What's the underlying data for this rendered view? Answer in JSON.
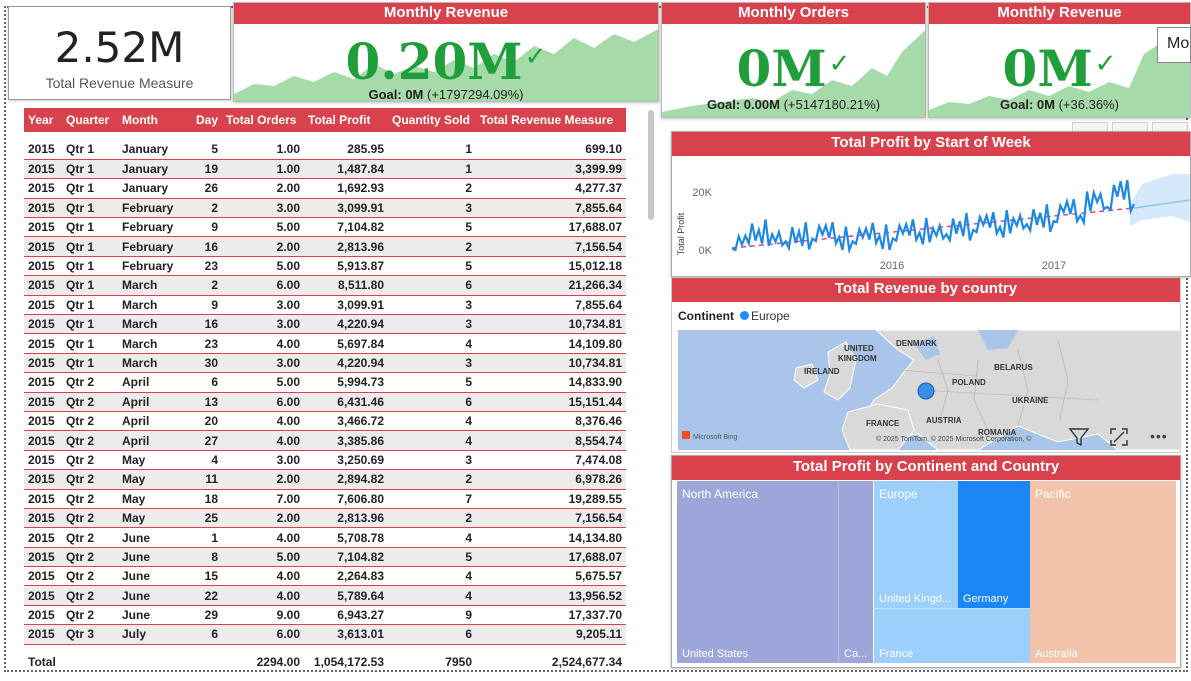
{
  "kpis": {
    "total_revenue": {
      "value": "2.52M",
      "label": "Total Revenue Measure"
    },
    "card1": {
      "title": "Monthly Revenue",
      "value": "0.20M",
      "goal_label": "Goal:",
      "goal_value": "0M",
      "delta": "(+1797294.09%)",
      "status_color": "#1f9e3a"
    },
    "card2": {
      "title": "Monthly Orders",
      "value": "0M",
      "goal_label": "Goal:",
      "goal_value": "0.00M",
      "delta": "(+5147180.21%)",
      "status_color": "#1f9e3a"
    },
    "card3": {
      "title": "Monthly Revenue",
      "value": "0M",
      "goal_label": "Goal:",
      "goal_value": "0M",
      "delta": "(+36.36%)",
      "status_color": "#1f9e3a"
    },
    "tick_glyph": "✓"
  },
  "tooltip": {
    "text": "Mo"
  },
  "table": {
    "columns": [
      "Year",
      "Quarter",
      "Month",
      "Day",
      "Total Orders",
      "Total Profit",
      "Quantity Sold",
      "Total Revenue Measure"
    ],
    "rows": [
      [
        "2015",
        "Qtr 1",
        "January",
        "5",
        "1.00",
        "285.95",
        "1",
        "699.10"
      ],
      [
        "2015",
        "Qtr 1",
        "January",
        "19",
        "1.00",
        "1,487.84",
        "1",
        "3,399.99"
      ],
      [
        "2015",
        "Qtr 1",
        "January",
        "26",
        "2.00",
        "1,692.93",
        "2",
        "4,277.37"
      ],
      [
        "2015",
        "Qtr 1",
        "February",
        "2",
        "3.00",
        "3,099.91",
        "3",
        "7,855.64"
      ],
      [
        "2015",
        "Qtr 1",
        "February",
        "9",
        "5.00",
        "7,104.82",
        "5",
        "17,688.07"
      ],
      [
        "2015",
        "Qtr 1",
        "February",
        "16",
        "2.00",
        "2,813.96",
        "2",
        "7,156.54"
      ],
      [
        "2015",
        "Qtr 1",
        "February",
        "23",
        "5.00",
        "5,913.87",
        "5",
        "15,012.18"
      ],
      [
        "2015",
        "Qtr 1",
        "March",
        "2",
        "6.00",
        "8,511.80",
        "6",
        "21,266.34"
      ],
      [
        "2015",
        "Qtr 1",
        "March",
        "9",
        "3.00",
        "3,099.91",
        "3",
        "7,855.64"
      ],
      [
        "2015",
        "Qtr 1",
        "March",
        "16",
        "3.00",
        "4,220.94",
        "3",
        "10,734.81"
      ],
      [
        "2015",
        "Qtr 1",
        "March",
        "23",
        "4.00",
        "5,697.84",
        "4",
        "14,109.80"
      ],
      [
        "2015",
        "Qtr 1",
        "March",
        "30",
        "3.00",
        "4,220.94",
        "3",
        "10,734.81"
      ],
      [
        "2015",
        "Qtr 2",
        "April",
        "6",
        "5.00",
        "5,994.73",
        "5",
        "14,833.90"
      ],
      [
        "2015",
        "Qtr 2",
        "April",
        "13",
        "6.00",
        "6,431.46",
        "6",
        "15,151.44"
      ],
      [
        "2015",
        "Qtr 2",
        "April",
        "20",
        "4.00",
        "3,466.72",
        "4",
        "8,376.46"
      ],
      [
        "2015",
        "Qtr 2",
        "April",
        "27",
        "4.00",
        "3,385.86",
        "4",
        "8,554.74"
      ],
      [
        "2015",
        "Qtr 2",
        "May",
        "4",
        "3.00",
        "3,250.69",
        "3",
        "7,474.08"
      ],
      [
        "2015",
        "Qtr 2",
        "May",
        "11",
        "2.00",
        "2,894.82",
        "2",
        "6,978.26"
      ],
      [
        "2015",
        "Qtr 2",
        "May",
        "18",
        "7.00",
        "7,606.80",
        "7",
        "19,289.55"
      ],
      [
        "2015",
        "Qtr 2",
        "May",
        "25",
        "2.00",
        "2,813.96",
        "2",
        "7,156.54"
      ],
      [
        "2015",
        "Qtr 2",
        "June",
        "1",
        "4.00",
        "5,708.78",
        "4",
        "14,134.80"
      ],
      [
        "2015",
        "Qtr 2",
        "June",
        "8",
        "5.00",
        "7,104.82",
        "5",
        "17,688.07"
      ],
      [
        "2015",
        "Qtr 2",
        "June",
        "15",
        "4.00",
        "2,264.83",
        "4",
        "5,675.57"
      ],
      [
        "2015",
        "Qtr 2",
        "June",
        "22",
        "4.00",
        "5,789.64",
        "4",
        "13,956.52"
      ],
      [
        "2015",
        "Qtr 2",
        "June",
        "29",
        "9.00",
        "6,943.27",
        "9",
        "17,337.70"
      ],
      [
        "2015",
        "Qtr 3",
        "July",
        "6",
        "6.00",
        "3,613.01",
        "6",
        "9,205.11"
      ]
    ],
    "total": {
      "label": "Total",
      "orders": "2294.00",
      "profit": "1,054,172.53",
      "qty": "7950",
      "revenue": "2,524,677.34"
    }
  },
  "line_chart": {
    "title": "Total Profit by Start of Week",
    "ylabel": "Total Profit",
    "yticks": [
      "20K",
      "0K"
    ],
    "xticks": [
      "2016",
      "2017"
    ]
  },
  "map": {
    "title": "Total Revenue by country",
    "legend_title": "Continent",
    "legend_item": "Europe",
    "legend_color": "#1f8fff",
    "labels": [
      "UNITED",
      "KINGDOM",
      "DENMARK",
      "IRELAND",
      "BELARUS",
      "POLAND",
      "UKRAINE",
      "FRANCE",
      "AUSTRIA",
      "ROMANIA"
    ],
    "attribution": "© 2025 TomTom, © 2025 Microsoft Corporation, ©",
    "bing": "Microsoft Bing"
  },
  "treemap": {
    "title": "Total Profit by Continent and Country",
    "continents": [
      "North America",
      "Europe",
      "Pacific"
    ],
    "countries": [
      "United States",
      "Ca...",
      "United Kingd...",
      "Germany",
      "France",
      "Australia"
    ]
  },
  "toolbar": {
    "more": "•••"
  },
  "chart_data": {
    "type": "line",
    "title": "Total Profit by Start of Week",
    "ylabel": "Total Profit",
    "x": [
      "2015-01-05",
      "2015-02-02",
      "2015-03-02",
      "2015-04-06",
      "2015-05-04",
      "2015-06-01",
      "2015-07-06",
      "2015-08-03",
      "2015-09-07",
      "2015-10-05",
      "2015-11-02",
      "2015-12-07",
      "2016-01-04",
      "2016-02-01",
      "2016-03-07",
      "2016-04-04",
      "2016-05-02",
      "2016-06-06",
      "2016-07-04",
      "2016-08-01",
      "2016-09-05",
      "2016-10-03",
      "2016-11-07",
      "2016-12-05",
      "2017-01-02",
      "2017-02-06",
      "2017-03-06",
      "2017-04-03",
      "2017-05-01",
      "2017-06-05",
      "2017-07-03"
    ],
    "series": [
      {
        "values": [
          500,
          5000,
          7000,
          5500,
          3000,
          6500,
          4000,
          8500,
          4500,
          3000,
          7500,
          5000,
          4000,
          9000,
          6000,
          7500,
          5500,
          10000,
          7000,
          12000,
          8000,
          11000,
          9000,
          13000,
          10000,
          17000,
          12000,
          20000,
          15000,
          24000,
          16000
        ]
      }
    ],
    "ylim": [
      0,
      30000
    ],
    "forecast": true,
    "trend_line": true
  }
}
